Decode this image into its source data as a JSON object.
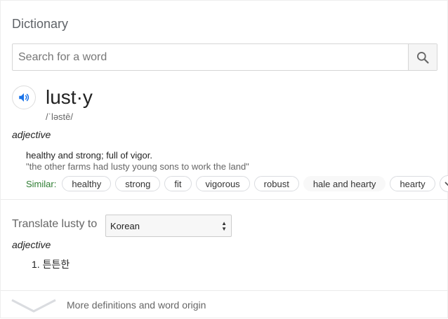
{
  "header": {
    "title": "Dictionary"
  },
  "search": {
    "placeholder": "Search for a word",
    "value": ""
  },
  "entry": {
    "word": "lust·y",
    "phonetic": "/ˈləstē/",
    "part_of_speech": "adjective",
    "definition": "healthy and strong; full of vigor.",
    "example": "\"the other farms had lusty young sons to work the land\"",
    "similar_label": "Similar:",
    "similar": [
      "healthy",
      "strong",
      "fit",
      "vigorous",
      "robust",
      "hale and hearty",
      "hearty"
    ]
  },
  "translate": {
    "label": "Translate lusty to",
    "language": "Korean",
    "part_of_speech": "adjective",
    "items": [
      "1. 튼튼한"
    ]
  },
  "footer": {
    "more_label": "More definitions and word origin"
  },
  "colors": {
    "accent_blue": "#1a73e8",
    "similar_green": "#2e7d32"
  },
  "icons": [
    "search-icon",
    "speaker-icon",
    "chevron-down-icon",
    "select-arrows-icon"
  ]
}
